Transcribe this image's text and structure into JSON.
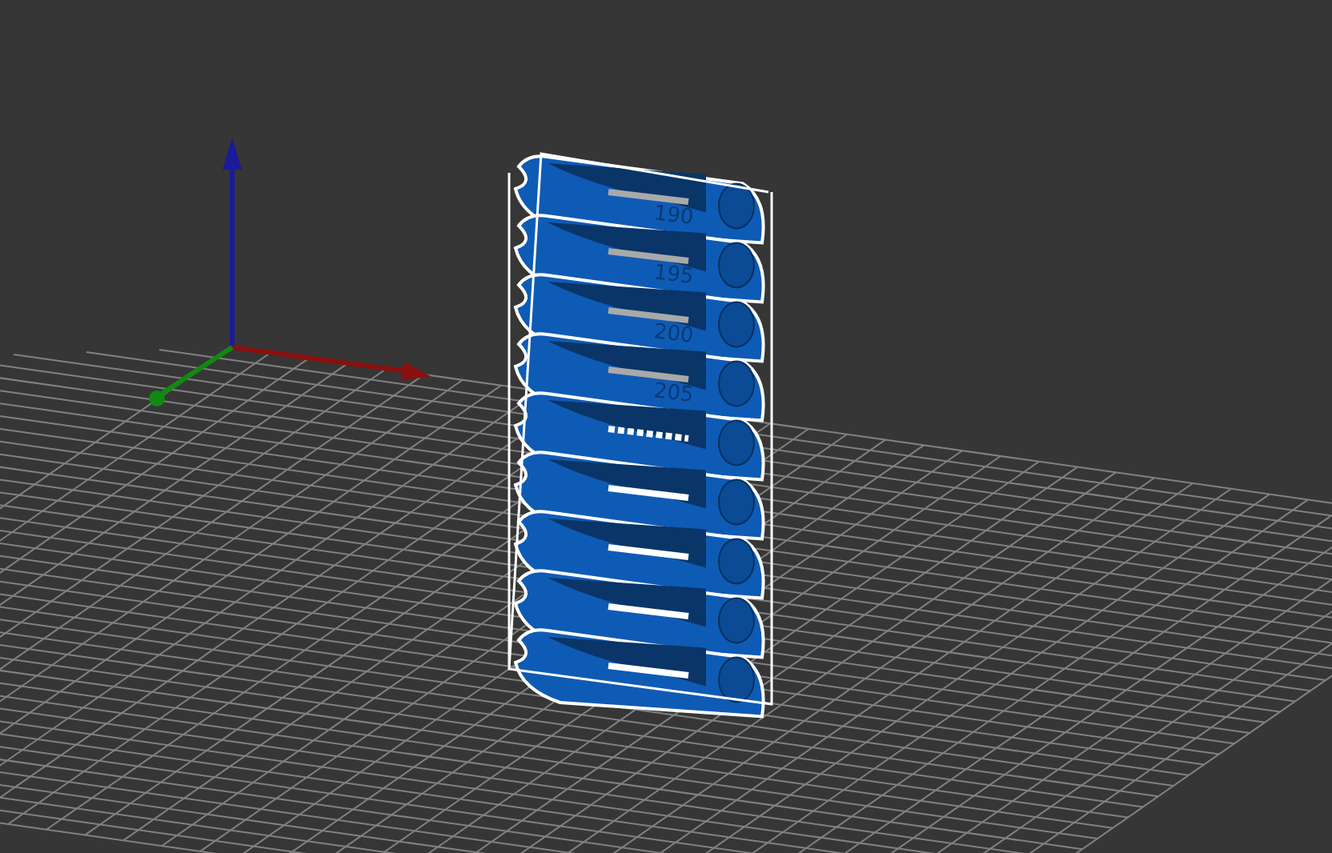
{
  "viewport": {
    "model": {
      "tiers": [
        {
          "kind": "labeled",
          "label": "190"
        },
        {
          "kind": "labeled",
          "label": "195"
        },
        {
          "kind": "labeled",
          "label": "200"
        },
        {
          "kind": "labeled",
          "label": "205"
        },
        {
          "kind": "unlabeled"
        },
        {
          "kind": "unlabeled"
        },
        {
          "kind": "unlabeled"
        },
        {
          "kind": "unlabeled"
        },
        {
          "kind": "unlabeled"
        }
      ]
    }
  }
}
